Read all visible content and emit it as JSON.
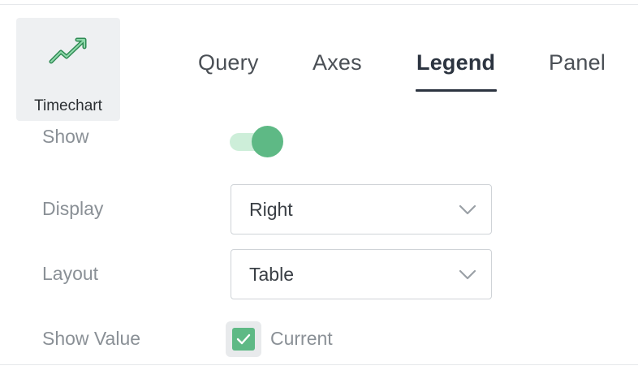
{
  "visualization": {
    "label": "Timechart",
    "icon": "trend-chart-icon"
  },
  "tabs": [
    {
      "label": "Query"
    },
    {
      "label": "Axes"
    },
    {
      "label": "Legend",
      "active": true
    },
    {
      "label": "Panel"
    }
  ],
  "legend": {
    "show_label": "Show",
    "show_enabled": true,
    "display_label": "Display",
    "display_value": "Right",
    "layout_label": "Layout",
    "layout_value": "Table",
    "show_value_label": "Show Value",
    "current_label": "Current",
    "current_checked": true
  },
  "colors": {
    "accent": "#5eb985",
    "toggle_track": "#cdeed9",
    "active_tab": "#2c3440"
  }
}
